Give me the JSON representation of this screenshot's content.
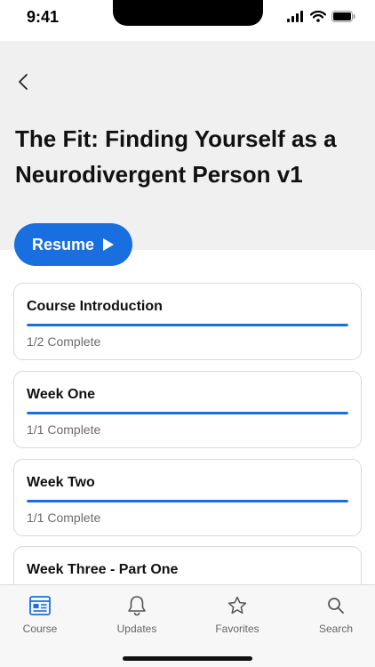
{
  "status_bar": {
    "time": "9:41"
  },
  "header": {
    "title": "The Fit: Finding Yourself as a Neurodivergent Person v1"
  },
  "resume_label": "Resume",
  "colors": {
    "accent": "#1a6fe0",
    "header_bg": "#f0f0f0"
  },
  "sections": [
    {
      "title": "Course Introduction",
      "status": "1/2 Complete",
      "progress": 1.0
    },
    {
      "title": "Week One",
      "status": "1/1 Complete",
      "progress": 1.0
    },
    {
      "title": "Week Two",
      "status": "1/1 Complete",
      "progress": 1.0
    },
    {
      "title": "Week Three - Part One",
      "status": "",
      "progress": 0
    }
  ],
  "tabs": [
    {
      "label": "Course",
      "icon": "course-icon"
    },
    {
      "label": "Updates",
      "icon": "bell-icon"
    },
    {
      "label": "Favorites",
      "icon": "star-icon"
    },
    {
      "label": "Search",
      "icon": "search-icon"
    }
  ]
}
